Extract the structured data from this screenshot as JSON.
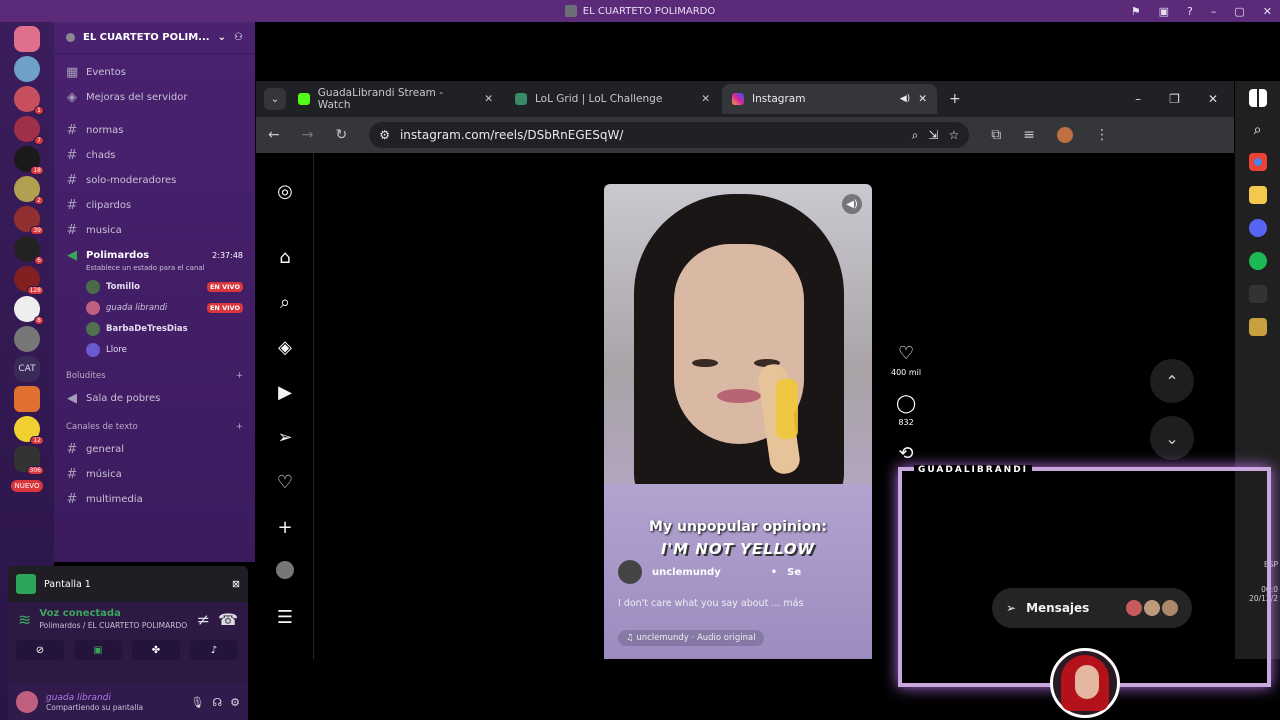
{
  "window": {
    "title": "EL CUARTETO POLIMARDO"
  },
  "servers": {
    "badges": [
      "1",
      "7",
      "18",
      "2",
      "39",
      "6",
      "128",
      "8",
      "12",
      "306"
    ],
    "cat_label": "CAT",
    "new_label": "NUEVO"
  },
  "guild": {
    "name": "EL CUARTETO POLIM...",
    "top_items": [
      {
        "label": "Eventos"
      },
      {
        "label": "Mejoras del servidor"
      }
    ],
    "channels": [
      "normas",
      "chads",
      "solo-moderadores",
      "clipardos",
      "musica"
    ],
    "voice_channel": {
      "name": "Polimardos",
      "timer": "2:37:48",
      "status": "Establece un estado para el canal",
      "users": [
        {
          "name": "Tomillo",
          "live": "EN VIVO"
        },
        {
          "name": "guada librandi",
          "live": "EN VIVO"
        },
        {
          "name": "BarbaDeTresDias",
          "live": ""
        },
        {
          "name": "Llore",
          "live": ""
        }
      ]
    },
    "cat1": {
      "name": "Boludites",
      "items": [
        "Sala de pobres"
      ]
    },
    "cat2": {
      "name": "Canales de texto",
      "items": [
        "general",
        "música",
        "multimedia"
      ]
    }
  },
  "panel": {
    "screen_label": "Pantalla 1",
    "voice_connected": "Voz conectada",
    "voice_location": "Polimardos / EL CUARTETO POLIMARDO",
    "user_name": "guada librandi",
    "user_status": "Compartiendo su pantalla"
  },
  "browser": {
    "tabs": [
      {
        "label": "GuadaLibrandi Stream - Watch"
      },
      {
        "label": "LoL Grid | LoL Challenge"
      },
      {
        "label": "Instagram"
      }
    ],
    "url": "instagram.com/reels/DSbRnEGESqW/"
  },
  "reel": {
    "caption_line1": "My unpopular opinion:",
    "caption_line2": "I'M NOT YELLOW",
    "username": "unclemundy",
    "follow_sep": "•",
    "follow_label": "Se",
    "description": "I don't care what you say about ... más",
    "audio": "♫ unclemundy · Audio original",
    "likes": "400 mil",
    "comments": "832",
    "messages_label": "Mensajes"
  },
  "overlay": {
    "tag": "GUADALIBRANDI"
  },
  "tray": {
    "lang": "ESP",
    "time": "00:0",
    "date": "20/12/2"
  },
  "colors": {
    "discord_purple": "#4a2270",
    "live_red": "#da373c",
    "voice_green": "#3ba55d"
  }
}
